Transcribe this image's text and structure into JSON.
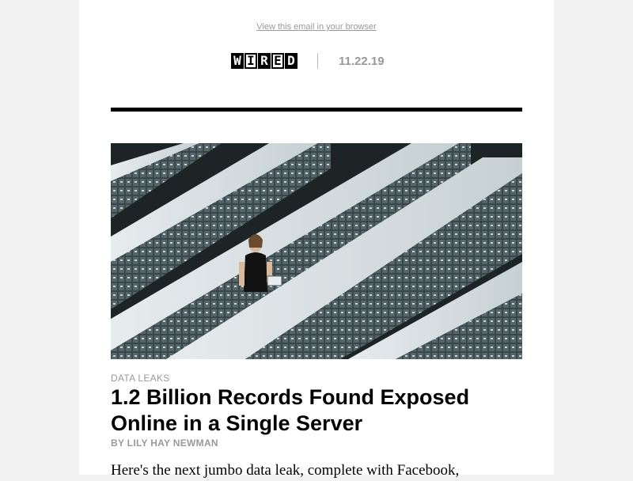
{
  "header": {
    "view_in_browser": "View this email in your browser",
    "logo_letters": [
      "W",
      "I",
      "R",
      "E",
      "D"
    ],
    "date": "11.22.19"
  },
  "article": {
    "category": "DATA LEAKS",
    "headline": "1.2 Billion Records Found Exposed Online in a Single Server",
    "byline": "BY LILY HAY NEWMAN",
    "excerpt": "Here's the next jumbo data leak, complete with Facebook,"
  },
  "colors": {
    "page_background": "#f2f2f2",
    "email_background": "#ffffff",
    "muted_text": "#999999",
    "rule": "#000000"
  }
}
